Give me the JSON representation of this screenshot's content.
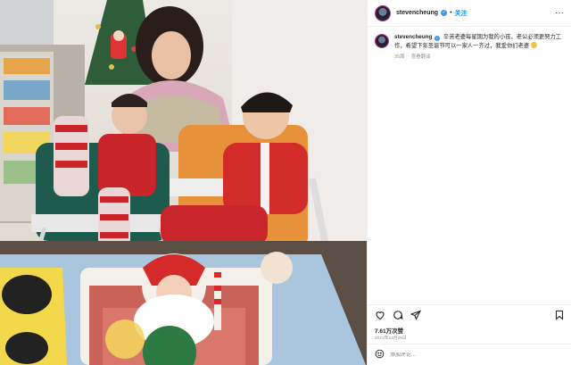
{
  "post": {
    "username": "stevencheung",
    "verified_mark": "✓",
    "separator": "•",
    "follow_label": "关注",
    "more_label": "···"
  },
  "caption": {
    "username": "stevencheung",
    "text": "辛苦老婆每星期为我的小孩，老公必须更努力工作，希望下年圣诞节可以一家人一齐过，我爱你们老婆",
    "time": "35周",
    "translate_label": "查看翻译"
  },
  "actions": {
    "like_icon": "heart-icon",
    "comment_icon": "comment-icon",
    "share_icon": "share-icon",
    "save_icon": "bookmark-icon"
  },
  "likes": "7.61万次赞",
  "date": "2021年12月25日",
  "comment": {
    "placeholder": "添加评论...",
    "emoji_icon": "smiley-icon"
  },
  "photo": {
    "alt": "Two toddlers in Christmas outfits sitting in high chairs next to a woman and a Christmas tree, with a Santa cake on the table"
  },
  "colors": {
    "link_blue": "#0095f6",
    "verified_blue": "#3897f0",
    "meta_gray": "#8e8e8e"
  }
}
